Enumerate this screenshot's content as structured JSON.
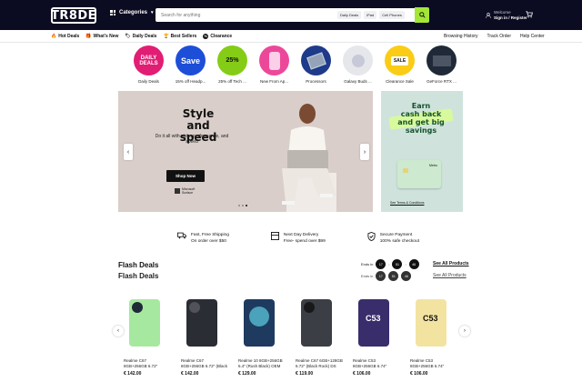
{
  "header": {
    "logo": "TR8DE",
    "categories_label": "Categories",
    "search_placeholder": "Search for anything",
    "search_chips": [
      "Daily Deals",
      "iPad",
      "Cell Phones"
    ],
    "account_line1": "Welcome",
    "account_line2": "Sign in / Register",
    "accent": "#a3e635"
  },
  "nav": {
    "left": [
      "Hot Deals",
      "What's New",
      "Daily Deals",
      "Best Sellers",
      "Clearance"
    ],
    "right": [
      "Browsing History",
      "Track Order",
      "Help Center"
    ]
  },
  "circles": [
    {
      "label": "Daily Deals",
      "text": "DAILY DEALS",
      "color": "#e11d74"
    },
    {
      "label": "15% off Headp...",
      "text": "Save",
      "color": "#1d4ed8"
    },
    {
      "label": "25% off Tech ...",
      "text": "25%",
      "color": "#84cc16"
    },
    {
      "label": "New From Ap...",
      "text": "",
      "color": "#ec4899"
    },
    {
      "label": "Processors",
      "text": "",
      "color": "#1e3a8a"
    },
    {
      "label": "Galaxy Buds ...",
      "text": "",
      "color": "#e5e7eb"
    },
    {
      "label": "Clearance Sale",
      "text": "SALE",
      "color": "#facc15"
    },
    {
      "label": "GeForce RTX ...",
      "text": "",
      "color": "#1f2937"
    }
  ],
  "hero": {
    "title_line1": "Style",
    "title_line2": "and",
    "title_line3": "speed",
    "subtitle": "Do it all with style, performance, and speed",
    "cta": "Shop Now",
    "brand_line1": "Microsoft",
    "brand_line2": "Surface"
  },
  "promo": {
    "headline_line1": "Earn",
    "headline_line2": "cash back",
    "headline_line3": "and get big",
    "headline_line4": "savings",
    "card_label": "Metro",
    "terms": "See Terms & Conditions"
  },
  "features": [
    {
      "title": "Fast, Free Shipping",
      "sub": "On order over $50"
    },
    {
      "title": "Next Day Delivery",
      "sub": "Free- spend over $99"
    },
    {
      "title": "Secure Payment",
      "sub": "100% safe checkout"
    }
  ],
  "flash": {
    "title": "Flash Deals",
    "ends_label": "Ends in",
    "timer": [
      "17",
      "51",
      "46"
    ],
    "see_all": "See All Products"
  },
  "products": [
    {
      "name_line1": "Realme C67",
      "name_line2": "8GB+256GB 6.72\"",
      "price": "€ 142.00",
      "color": "#a7e8a0"
    },
    {
      "name_line1": "Realme C67",
      "name_line2": "8GB+256GB 6.72\" (Black",
      "price": "€ 142.00",
      "color": "#2a2d33"
    },
    {
      "name_line1": "Realme 10 8GB+256GB",
      "name_line2": "6.4\" (Rush Black) OEM",
      "price": "€ 129.00",
      "color": "#1e3a5f"
    },
    {
      "name_line1": "Realme C67 6GB+128GB",
      "name_line2": "6.72\" (Black Rock) DS",
      "price": "€ 119.00",
      "color": "#3b3f45"
    },
    {
      "name_line1": "Realme C53",
      "name_line2": "8GB+256GB 6.74\"",
      "price": "€ 106.00",
      "color": "#3a2d6b"
    },
    {
      "name_line1": "Realme C53",
      "name_line2": "8GB+256GB 6.74\"",
      "price": "€ 106.00",
      "color": "#f3e3a1"
    }
  ]
}
